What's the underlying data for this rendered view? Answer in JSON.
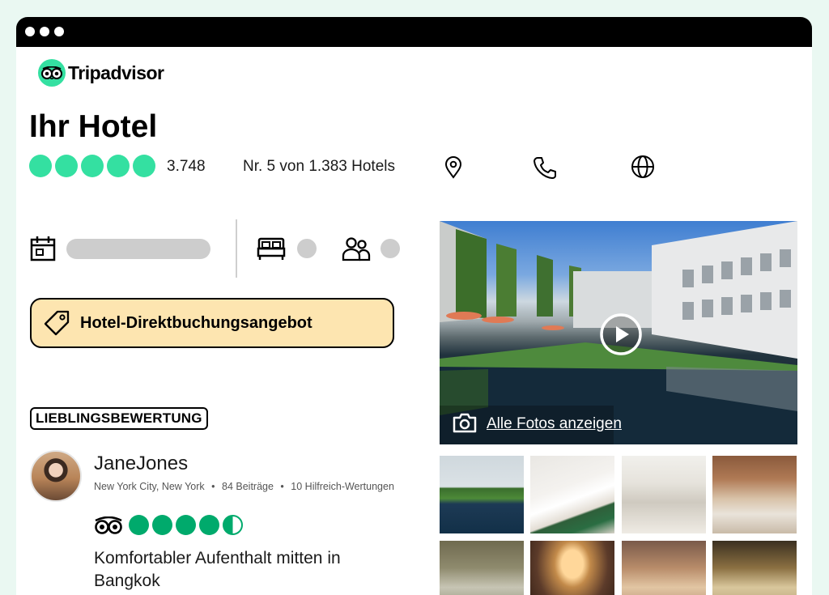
{
  "brand": {
    "name": "Tripadvisor",
    "color": "#34e0a1"
  },
  "hotel": {
    "title": "Ihr Hotel",
    "rating_bubbles": 5,
    "review_count": "3.748",
    "rank_text": "Nr. 5 von 1.383 Hotels"
  },
  "contact_icons": [
    "location-pin-icon",
    "phone-icon",
    "globe-icon"
  ],
  "booking": {
    "date_icon": "calendar-icon",
    "rooms_icon": "bed-icon",
    "guests_icon": "guests-icon"
  },
  "deal": {
    "label": "Hotel-Direktbuchungsangebot",
    "color": "#fde5b0"
  },
  "review": {
    "badge": "LIEBLINGSBEWERTUNG",
    "username": "JaneJones",
    "location": "New York City, New York",
    "contributions": "84 Beiträge",
    "helpful": "10 Hilfreich-Wertungen",
    "rating": 4.5,
    "title": "Komfortabler Aufenthalt mitten in Bangkok",
    "rating_color": "#00aa6c"
  },
  "gallery": {
    "see_all_label": "Alle Fotos anzeigen",
    "thumbnail_count": 8
  }
}
